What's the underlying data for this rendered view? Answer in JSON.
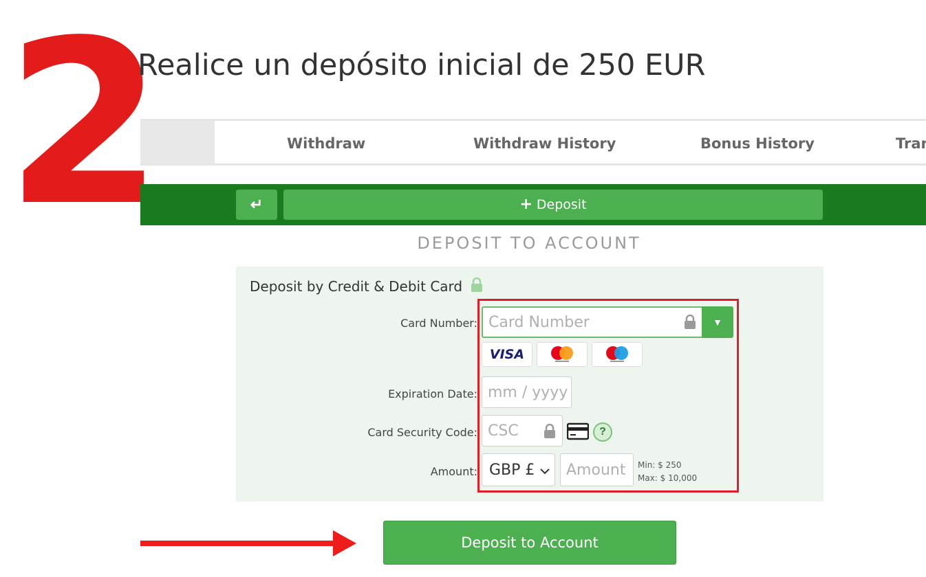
{
  "step": {
    "number": "2",
    "headline": "Realice un depósito inicial de 250 EUR"
  },
  "tabs": [
    {
      "label": "Withdraw"
    },
    {
      "label": "Withdraw History"
    },
    {
      "label": "Bonus History"
    },
    {
      "label": "Tran"
    }
  ],
  "actionbar": {
    "back_icon": "return-arrow-icon",
    "deposit_label": "Deposit"
  },
  "section_title": "DEPOSIT TO ACCOUNT",
  "form": {
    "title": "Deposit by Credit & Debit Card",
    "card_number": {
      "label": "Card Number:",
      "placeholder": "Card Number"
    },
    "card_logos": [
      "VISA",
      "Mastercard",
      "Maestro"
    ],
    "expiration": {
      "label": "Expiration Date:",
      "placeholder": "mm / yyyy"
    },
    "csc": {
      "label": "Card Security Code:",
      "placeholder": "CSC",
      "help": "?"
    },
    "amount": {
      "label": "Amount:",
      "currency": "GBP £",
      "placeholder": "Amount",
      "min": "Min: $ 250",
      "max": "Max: $ 10,000"
    }
  },
  "submit_label": "Deposit to Account",
  "colors": {
    "accent_green": "#4caf50",
    "dark_green": "#1a7a20",
    "highlight_red": "#e21d2a"
  }
}
